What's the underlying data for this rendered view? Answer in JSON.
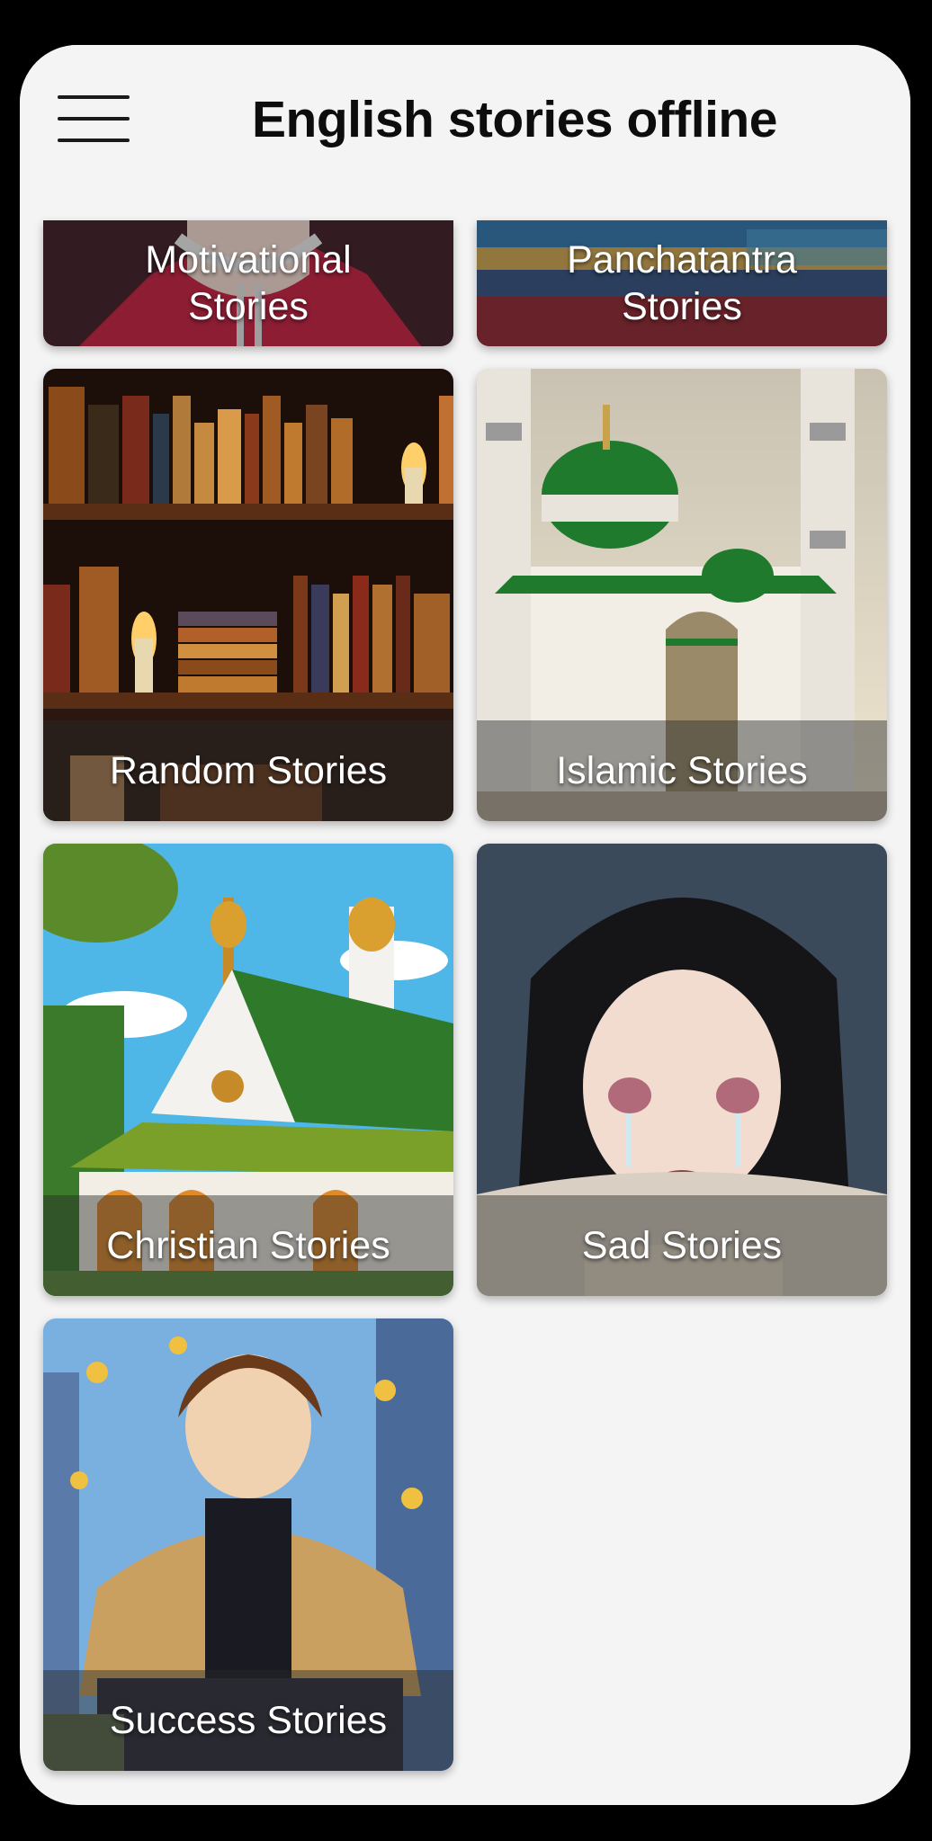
{
  "app_bar": {
    "title": "English stories offline",
    "menu_icon": "hamburger-menu-icon"
  },
  "categories": [
    {
      "label": "Motivational\nStories",
      "image": "person in red jacket"
    },
    {
      "label": "Panchatantra\nStories",
      "image": "colorful blurred scene"
    },
    {
      "label": "Random Stories",
      "image": "bookshelf with candles"
    },
    {
      "label": "Islamic Stories",
      "image": "mosque with green dome"
    },
    {
      "label": "Christian Stories",
      "image": "church with green roof"
    },
    {
      "label": "Sad Stories",
      "image": "crying anime girl"
    },
    {
      "label": "Success Stories",
      "image": "smiling man with coins"
    }
  ]
}
